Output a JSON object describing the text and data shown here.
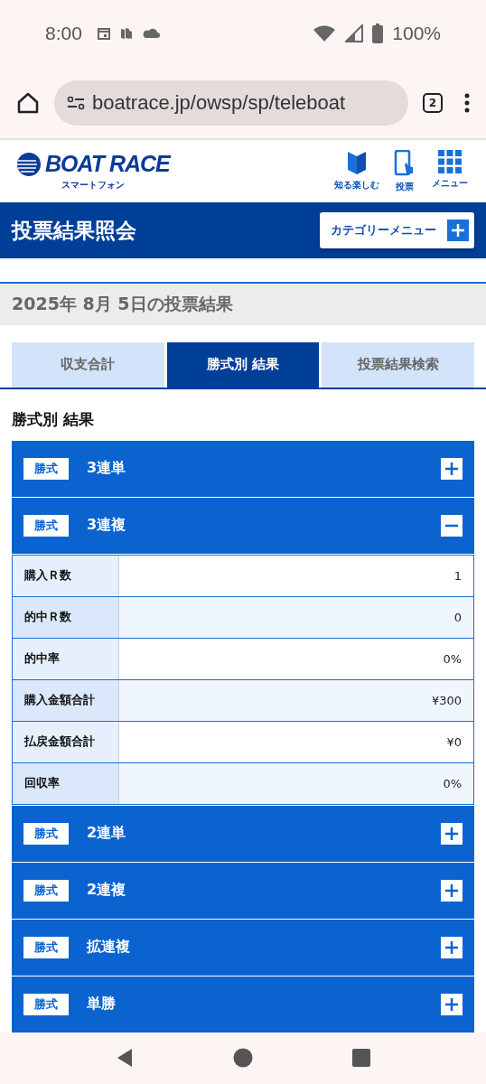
{
  "status_bar": {
    "time": "8:00",
    "battery": "100%"
  },
  "browser": {
    "url": "boatrace.jp/owsp/sp/teleboat",
    "tab_count": "2"
  },
  "header": {
    "logo": "BOAT RACE",
    "logo_sub": "スマートフォン",
    "nav": [
      {
        "label": "知る楽しむ",
        "kind": "beginner"
      },
      {
        "label": "投票",
        "kind": "phone"
      },
      {
        "label": "メニュー",
        "kind": "grid"
      }
    ]
  },
  "title_bar": {
    "title": "投票結果照会",
    "menu_button": "カテゴリーメニュー"
  },
  "date_heading": "2025年 8月 5日の投票結果",
  "tabs": [
    {
      "label": "収支合計",
      "selected": false
    },
    {
      "label": "勝式別 結果",
      "selected": true
    },
    {
      "label": "投票結果検索",
      "selected": false
    }
  ],
  "section_title": "勝式別 結果",
  "bet_types": [
    {
      "badge": "勝式",
      "name": "3連単",
      "expanded": false
    },
    {
      "badge": "勝式",
      "name": "3連複",
      "expanded": true,
      "rows": [
        {
          "label": "購入Ｒ数",
          "value": "1"
        },
        {
          "label": "的中Ｒ数",
          "value": "0"
        },
        {
          "label": "的中率",
          "value": "0%"
        },
        {
          "label": "購入金額合計",
          "value": "¥300"
        },
        {
          "label": "払戻金額合計",
          "value": "¥0"
        },
        {
          "label": "回収率",
          "value": "0%"
        }
      ]
    },
    {
      "badge": "勝式",
      "name": "2連単",
      "expanded": false
    },
    {
      "badge": "勝式",
      "name": "2連複",
      "expanded": false
    },
    {
      "badge": "勝式",
      "name": "拡連複",
      "expanded": false
    },
    {
      "badge": "勝式",
      "name": "単勝",
      "expanded": false
    }
  ]
}
